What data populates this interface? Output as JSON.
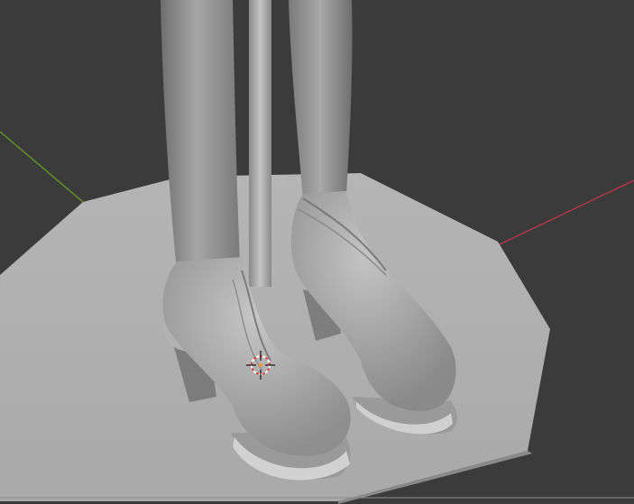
{
  "viewport": {
    "background_color": "#3b3b3b",
    "shading_mode": "solid",
    "icons": {
      "origin": "3d-cursor-icon",
      "axis_x": "x-axis-line",
      "axis_y": "y-axis-line"
    },
    "colors": {
      "x_axis": "#b0364a",
      "y_axis": "#5e8f27",
      "mesh_light": "#c8c8c8",
      "mesh_mid": "#9c9c9c",
      "mesh_dark": "#6e6e6e",
      "cursor_red": "#e0463a",
      "cursor_white": "#ffffff"
    },
    "objects": [
      "display-base",
      "support-pole",
      "left-leg",
      "right-leg",
      "left-shoe",
      "right-shoe"
    ]
  }
}
